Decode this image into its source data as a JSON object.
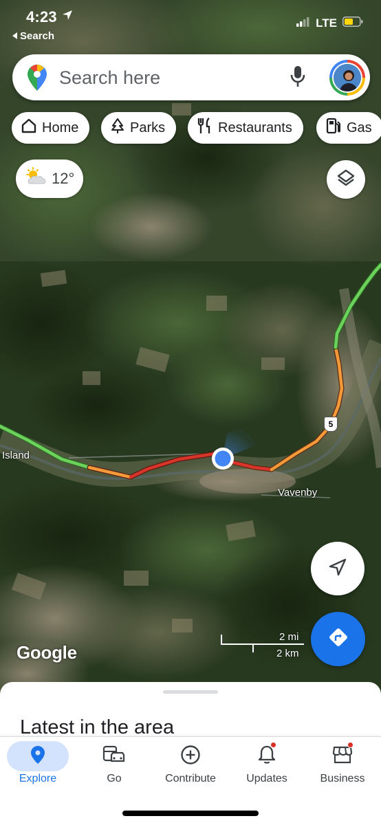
{
  "status_bar": {
    "time": "4:23",
    "back_label": "Search",
    "network": "LTE",
    "battery_color": "#ffd60a"
  },
  "search": {
    "placeholder": "Search here",
    "mic_icon": "mic-icon",
    "avatar": "profile-avatar"
  },
  "chips": [
    {
      "label": "Home",
      "icon": "home-icon"
    },
    {
      "label": "Parks",
      "icon": "tree-icon"
    },
    {
      "label": "Restaurants",
      "icon": "fork-knife-icon"
    },
    {
      "label": "Gas",
      "icon": "gas-pump-icon"
    }
  ],
  "weather": {
    "temperature": "12°",
    "icon": "partly-cloudy-icon"
  },
  "map": {
    "labels": {
      "island": "Island",
      "vavenby": "Vavenby"
    },
    "route_shield": "5",
    "attribution": "Google",
    "scale_mi": "2 mi",
    "scale_km": "2 km",
    "colors": {
      "traffic_green": "#6bd35b",
      "traffic_orange": "#f29a3a",
      "traffic_red": "#d8352a",
      "location_dot": "#4285f4",
      "accent_blue": "#1a73e8"
    }
  },
  "sheet": {
    "title": "Latest in the area"
  },
  "nav": {
    "items": [
      {
        "label": "Explore",
        "icon": "explore-pin-icon",
        "active": true
      },
      {
        "label": "Go",
        "icon": "commute-icon",
        "active": false
      },
      {
        "label": "Contribute",
        "icon": "add-circle-icon",
        "active": false
      },
      {
        "label": "Updates",
        "icon": "bell-icon",
        "active": false,
        "badge": true
      },
      {
        "label": "Business",
        "icon": "storefront-icon",
        "active": false,
        "badge": true
      }
    ]
  }
}
